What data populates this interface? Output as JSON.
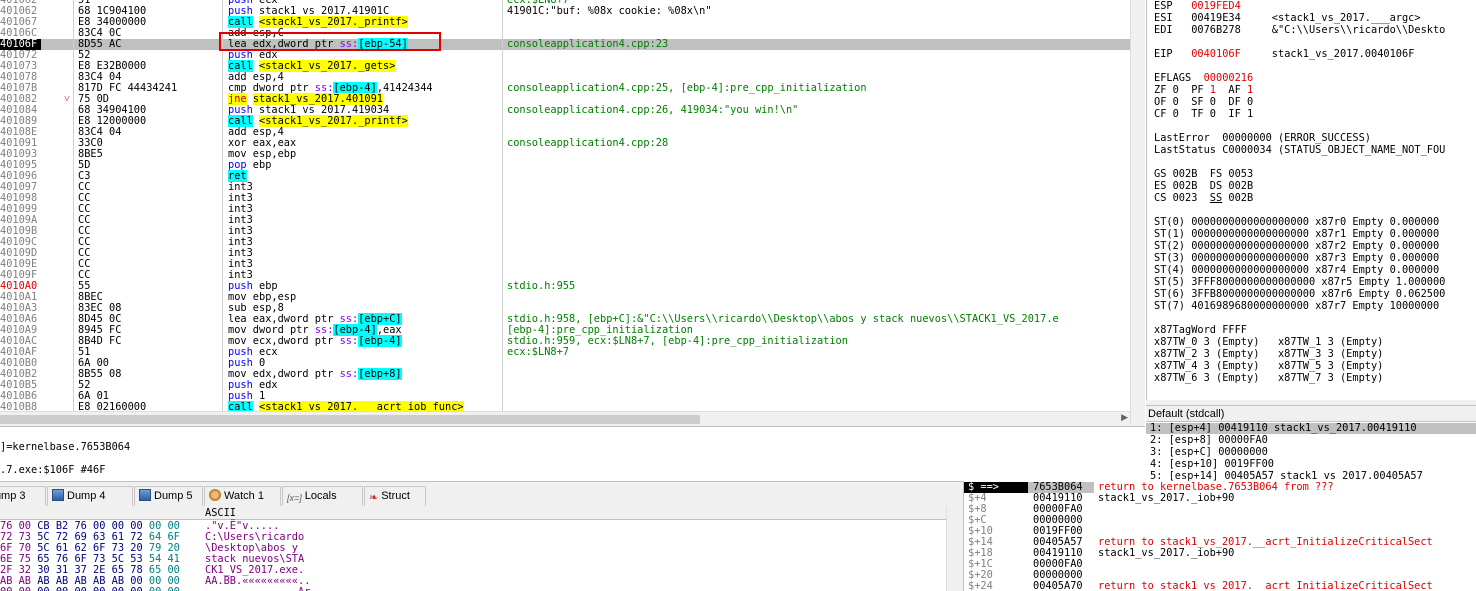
{
  "disasm": [
    {
      "addr": "401062",
      "bytes": "51",
      "instr": [
        [
          "push",
          "t-push"
        ],
        [
          " ecx",
          ""
        ]
      ],
      "cmt": "ecx:$LN8+7"
    },
    {
      "addr": "401062",
      "bytes": "68 1C904100",
      "instr": [
        [
          "push",
          "t-push"
        ],
        [
          " stack1_vs_2017.41901C",
          ""
        ]
      ],
      "cmt": "41901C:\"buf: %08x cookie: %08x\\n\""
    },
    {
      "addr": "401067",
      "bytes": "E8 34000000",
      "instr": [
        [
          "call",
          "t-call"
        ],
        [
          " ",
          ""
        ],
        [
          "<stack1_vs_2017._printf>",
          "t-lbl"
        ]
      ],
      "cmt": ""
    },
    {
      "addr": "40106C",
      "bytes": "83C4 0C",
      "instr": [
        [
          "add esp,C",
          ""
        ]
      ],
      "cmt": ""
    },
    {
      "addr": "40106F",
      "bytes": "8D55 AC",
      "instr": [
        [
          "lea edx,dword ptr ",
          ""
        ],
        [
          "ss:",
          "t-seg"
        ],
        [
          "[ebp-54]",
          "t-mem"
        ]
      ],
      "cmt": "consoleapplication4.cpp:23",
      "cur": true
    },
    {
      "addr": "401072",
      "bytes": "52",
      "instr": [
        [
          "push",
          "t-push"
        ],
        [
          " edx",
          ""
        ]
      ],
      "cmt": ""
    },
    {
      "addr": "401073",
      "bytes": "E8 E32B0000",
      "instr": [
        [
          "call",
          "t-call"
        ],
        [
          " ",
          ""
        ],
        [
          "<stack1_vs_2017._gets>",
          "t-lbl"
        ]
      ],
      "cmt": ""
    },
    {
      "addr": "401078",
      "bytes": "83C4 04",
      "instr": [
        [
          "add esp,4",
          ""
        ]
      ],
      "cmt": ""
    },
    {
      "addr": "40107B",
      "bytes": "817D FC 44434241",
      "instr": [
        [
          "cmp dword ptr ",
          ""
        ],
        [
          "ss:",
          "t-seg"
        ],
        [
          "[ebp-4]",
          "t-mem"
        ],
        [
          ",41424344",
          ""
        ]
      ],
      "cmt": "consoleapplication4.cpp:25, [ebp-4]:pre_cpp_initialization"
    },
    {
      "addr": "401082",
      "bytes": "75 0D",
      "instr": [
        [
          "jne",
          "t-jmp"
        ],
        [
          " ",
          ""
        ],
        [
          "stack1_vs_2017.401091",
          "t-lbl"
        ]
      ],
      "cmt": "",
      "arrow": true
    },
    {
      "addr": "401084",
      "bytes": "68 34904100",
      "instr": [
        [
          "push",
          "t-push"
        ],
        [
          " stack1_vs_2017.419034",
          ""
        ]
      ],
      "cmt": "consoleapplication4.cpp:26, 419034:\"you win!\\n\""
    },
    {
      "addr": "401089",
      "bytes": "E8 12000000",
      "instr": [
        [
          "call",
          "t-call"
        ],
        [
          " ",
          ""
        ],
        [
          "<stack1_vs_2017._printf>",
          "t-lbl"
        ]
      ],
      "cmt": ""
    },
    {
      "addr": "40108E",
      "bytes": "83C4 04",
      "instr": [
        [
          "add esp,4",
          ""
        ]
      ],
      "cmt": ""
    },
    {
      "addr": "401091",
      "bytes": "33C0",
      "instr": [
        [
          "xor eax,eax",
          ""
        ]
      ],
      "cmt": "consoleapplication4.cpp:28"
    },
    {
      "addr": "401093",
      "bytes": "8BE5",
      "instr": [
        [
          "mov esp,ebp",
          ""
        ]
      ],
      "cmt": ""
    },
    {
      "addr": "401095",
      "bytes": "5D",
      "instr": [
        [
          "pop",
          "t-push"
        ],
        [
          " ebp",
          ""
        ]
      ],
      "cmt": ""
    },
    {
      "addr": "401096",
      "bytes": "C3",
      "instr": [
        [
          "ret",
          "t-ret"
        ]
      ],
      "cmt": ""
    },
    {
      "addr": "401097",
      "bytes": "CC",
      "instr": [
        [
          "int3",
          ""
        ]
      ],
      "cmt": ""
    },
    {
      "addr": "401098",
      "bytes": "CC",
      "instr": [
        [
          "int3",
          ""
        ]
      ],
      "cmt": ""
    },
    {
      "addr": "401099",
      "bytes": "CC",
      "instr": [
        [
          "int3",
          ""
        ]
      ],
      "cmt": ""
    },
    {
      "addr": "40109A",
      "bytes": "CC",
      "instr": [
        [
          "int3",
          ""
        ]
      ],
      "cmt": ""
    },
    {
      "addr": "40109B",
      "bytes": "CC",
      "instr": [
        [
          "int3",
          ""
        ]
      ],
      "cmt": ""
    },
    {
      "addr": "40109C",
      "bytes": "CC",
      "instr": [
        [
          "int3",
          ""
        ]
      ],
      "cmt": ""
    },
    {
      "addr": "40109D",
      "bytes": "CC",
      "instr": [
        [
          "int3",
          ""
        ]
      ],
      "cmt": ""
    },
    {
      "addr": "40109E",
      "bytes": "CC",
      "instr": [
        [
          "int3",
          ""
        ]
      ],
      "cmt": ""
    },
    {
      "addr": "40109F",
      "bytes": "CC",
      "instr": [
        [
          "int3",
          ""
        ]
      ],
      "cmt": ""
    },
    {
      "addr": "4010A0",
      "bytes": "55",
      "instr": [
        [
          "push",
          "t-push"
        ],
        [
          " ebp",
          ""
        ]
      ],
      "cmt": "stdio.h:955",
      "eip": true
    },
    {
      "addr": "4010A1",
      "bytes": "8BEC",
      "instr": [
        [
          "mov ebp,esp",
          ""
        ]
      ],
      "cmt": ""
    },
    {
      "addr": "4010A3",
      "bytes": "83EC 08",
      "instr": [
        [
          "sub esp,8",
          ""
        ]
      ],
      "cmt": ""
    },
    {
      "addr": "4010A6",
      "bytes": "8D45 0C",
      "instr": [
        [
          "lea eax,dword ptr ",
          ""
        ],
        [
          "ss:",
          "t-seg"
        ],
        [
          "[ebp+C]",
          "t-mem"
        ]
      ],
      "cmt": "stdio.h:958, [ebp+C]:&\"C:\\\\Users\\\\ricardo\\\\Desktop\\\\abos y stack nuevos\\\\STACK1_VS_2017.e"
    },
    {
      "addr": "4010A9",
      "bytes": "8945 FC",
      "instr": [
        [
          "mov dword ptr ",
          ""
        ],
        [
          "ss:",
          "t-seg"
        ],
        [
          "[ebp-4]",
          "t-mem"
        ],
        [
          ",eax",
          ""
        ]
      ],
      "cmt": "[ebp-4]:pre_cpp_initialization"
    },
    {
      "addr": "4010AC",
      "bytes": "8B4D FC",
      "instr": [
        [
          "mov ecx,dword ptr ",
          ""
        ],
        [
          "ss:",
          "t-seg"
        ],
        [
          "[ebp-4]",
          "t-mem"
        ]
      ],
      "cmt": "stdio.h:959, ecx:$LN8+7, [ebp-4]:pre_cpp_initialization"
    },
    {
      "addr": "4010AF",
      "bytes": "51",
      "instr": [
        [
          "push",
          "t-push"
        ],
        [
          " ecx",
          ""
        ]
      ],
      "cmt": "ecx:$LN8+7"
    },
    {
      "addr": "4010B0",
      "bytes": "6A 00",
      "instr": [
        [
          "push",
          "t-push"
        ],
        [
          " 0",
          ""
        ]
      ],
      "cmt": ""
    },
    {
      "addr": "4010B2",
      "bytes": "8B55 08",
      "instr": [
        [
          "mov edx,dword ptr ",
          ""
        ],
        [
          "ss:",
          "t-seg"
        ],
        [
          "[ebp+8]",
          "t-mem"
        ]
      ],
      "cmt": ""
    },
    {
      "addr": "4010B5",
      "bytes": "52",
      "instr": [
        [
          "push",
          "t-push"
        ],
        [
          " edx",
          ""
        ]
      ],
      "cmt": ""
    },
    {
      "addr": "4010B6",
      "bytes": "6A 01",
      "instr": [
        [
          "push",
          "t-push"
        ],
        [
          " 1",
          ""
        ]
      ],
      "cmt": ""
    },
    {
      "addr": "4010B8",
      "bytes": "E8 02160000",
      "instr": [
        [
          "call",
          "t-call"
        ],
        [
          " ",
          ""
        ],
        [
          "<stack1_vs_2017.___acrt_iob_func>",
          "t-lbl"
        ]
      ],
      "cmt": ""
    }
  ],
  "info": {
    "line1": "]=kernelbase.7653B064",
    "line2": ".7.exe:$106F #46F"
  },
  "regs": [
    {
      "t": [
        [
          "ESP   ",
          ""
        ],
        [
          "0019FED4",
          "rv"
        ]
      ]
    },
    {
      "t": [
        [
          "ESI   00419E34     <stack1_vs_2017.___argc>",
          ""
        ]
      ]
    },
    {
      "t": [
        [
          "EDI   0076B278     &\"C:\\\\Users\\\\ricardo\\\\Deskto",
          ""
        ]
      ]
    },
    {
      "t": [
        [
          "",
          ""
        ]
      ]
    },
    {
      "t": [
        [
          "EIP   ",
          ""
        ],
        [
          "0040106F",
          "rv"
        ],
        [
          "     stack1_vs_2017.0040106F",
          ""
        ]
      ]
    },
    {
      "t": [
        [
          "",
          ""
        ]
      ]
    },
    {
      "t": [
        [
          "EFLAGS  ",
          ""
        ],
        [
          "00000216",
          "rv"
        ]
      ]
    },
    {
      "t": [
        [
          "ZF 0  PF ",
          ""
        ],
        [
          "1",
          "rv"
        ],
        [
          "  AF ",
          ""
        ],
        [
          "1",
          "rv"
        ]
      ]
    },
    {
      "t": [
        [
          "OF 0  SF 0  DF 0",
          ""
        ]
      ]
    },
    {
      "t": [
        [
          "CF 0  TF 0  IF 1",
          ""
        ]
      ]
    },
    {
      "t": [
        [
          "",
          ""
        ]
      ]
    },
    {
      "t": [
        [
          "LastError  00000000 (ERROR_SUCCESS)",
          ""
        ]
      ]
    },
    {
      "t": [
        [
          "LastStatus C0000034 (STATUS_OBJECT_NAME_NOT_FOU",
          ""
        ]
      ]
    },
    {
      "t": [
        [
          "",
          ""
        ]
      ]
    },
    {
      "t": [
        [
          "GS 002B  FS 0053",
          ""
        ]
      ]
    },
    {
      "t": [
        [
          "ES 002B  DS 002B",
          ""
        ]
      ]
    },
    {
      "t": [
        [
          "CS 0023  ",
          ""
        ],
        [
          "SS",
          "ru"
        ],
        [
          " 002B",
          ""
        ]
      ]
    },
    {
      "t": [
        [
          "",
          ""
        ]
      ]
    },
    {
      "t": [
        [
          "ST(0) 0000000000000000000 x87r0 Empty 0.000000",
          ""
        ]
      ]
    },
    {
      "t": [
        [
          "ST(1) 0000000000000000000 x87r1 Empty 0.000000",
          ""
        ]
      ]
    },
    {
      "t": [
        [
          "ST(2) 0000000000000000000 x87r2 Empty 0.000000",
          ""
        ]
      ]
    },
    {
      "t": [
        [
          "ST(3) 0000000000000000000 x87r3 Empty 0.000000",
          ""
        ]
      ]
    },
    {
      "t": [
        [
          "ST(4) 0000000000000000000 x87r4 Empty 0.000000",
          ""
        ]
      ]
    },
    {
      "t": [
        [
          "ST(5) 3FFF8000000000000000 x87r5 Empty 1.000000",
          ""
        ]
      ]
    },
    {
      "t": [
        [
          "ST(6) 3FFB8000000000000000 x87r6 Empty 0.062500",
          ""
        ]
      ]
    },
    {
      "t": [
        [
          "ST(7) 4016989680000000000 x87r7 Empty 10000000",
          ""
        ]
      ]
    },
    {
      "t": [
        [
          "",
          ""
        ]
      ]
    },
    {
      "t": [
        [
          "x87TagWord FFFF",
          ""
        ]
      ]
    },
    {
      "t": [
        [
          "x87TW_0 3 (Empty)   x87TW_1 3 (Empty)",
          ""
        ]
      ]
    },
    {
      "t": [
        [
          "x87TW_2 3 (Empty)   x87TW_3 3 (Empty)",
          ""
        ]
      ]
    },
    {
      "t": [
        [
          "x87TW_4 3 (Empty)   x87TW_5 3 (Empty)",
          ""
        ]
      ]
    },
    {
      "t": [
        [
          "x87TW_6 3 (Empty)   x87TW_7 3 (Empty)",
          ""
        ]
      ]
    }
  ],
  "callconv": {
    "title": "Default (stdcall)",
    "lines": [
      "1: [esp+4] 00419110 stack1_vs_2017.00419110",
      "2: [esp+8] 00000FA0",
      "3: [esp+C] 00000000",
      "4: [esp+10] 0019FF00",
      "5: [esp+14] 00405A57 stack1_vs_2017.00405A57"
    ]
  },
  "tabs": [
    {
      "label": "Dump 3",
      "icon": "dump-icon"
    },
    {
      "label": "Dump 4",
      "icon": "dump-icon"
    },
    {
      "label": "Dump 5",
      "icon": "dump-icon"
    },
    {
      "label": "Watch 1",
      "icon": "watch-icon"
    },
    {
      "label": "Locals",
      "icon": "locals-icon",
      "prefix": "[x=]"
    },
    {
      "label": "Struct",
      "icon": "struct-icon"
    }
  ],
  "dump": {
    "ascii_header": "ASCII",
    "rows": [
      {
        "hex": "76 00 CB B2 76 00 00 00 00 00",
        "ascii": ".\"v.Ë\"v....."
      },
      {
        "hex": "72 73 5C 72 69 63 61 72 64 6F",
        "ascii": "C:\\Users\\ricardo"
      },
      {
        "hex": "6F 70 5C 61 62 6F 73 20 79 20",
        "ascii": "\\Desktop\\abos y"
      },
      {
        "hex": "6E 75 65 76 6F 73 5C 53 54 41",
        "ascii": "stack nuevos\\STA"
      },
      {
        "hex": "2F 32 30 31 37 2E 65 78 65 00",
        "ascii": "CK1_VS_2017.exe."
      },
      {
        "hex": "AB AB AB AB AB AB AB 00 00 00",
        "ascii": "AA.BB.«««««««««.."
      },
      {
        "hex": "00 00 00 00 00 00 00 00 00 00",
        "ascii": "...............Ar"
      }
    ]
  },
  "stack": [
    {
      "off": "$ ==>",
      "val": "7653B064",
      "cmt": "return to kernelbase.7653B064 from ???",
      "ret": true,
      "top": true
    },
    {
      "off": "$+4",
      "val": "00419110",
      "cmt": "stack1_vs_2017._iob+90"
    },
    {
      "off": "$+8",
      "val": "00000FA0",
      "cmt": ""
    },
    {
      "off": "$+C",
      "val": "00000000",
      "cmt": ""
    },
    {
      "off": "$+10",
      "val": "0019FF00",
      "cmt": ""
    },
    {
      "off": "$+14",
      "val": "00405A57",
      "cmt": "return to stack1_vs_2017.__acrt_InitializeCriticalSect",
      "ret": true
    },
    {
      "off": "$+18",
      "val": "00419110",
      "cmt": "stack1_vs_2017._iob+90"
    },
    {
      "off": "$+1C",
      "val": "00000FA0",
      "cmt": ""
    },
    {
      "off": "$+20",
      "val": "00000000",
      "cmt": ""
    },
    {
      "off": "$+24",
      "val": "00405A70",
      "cmt": "return to stack1_vs_2017.__acrt_InitializeCriticalSect",
      "ret": true
    }
  ]
}
